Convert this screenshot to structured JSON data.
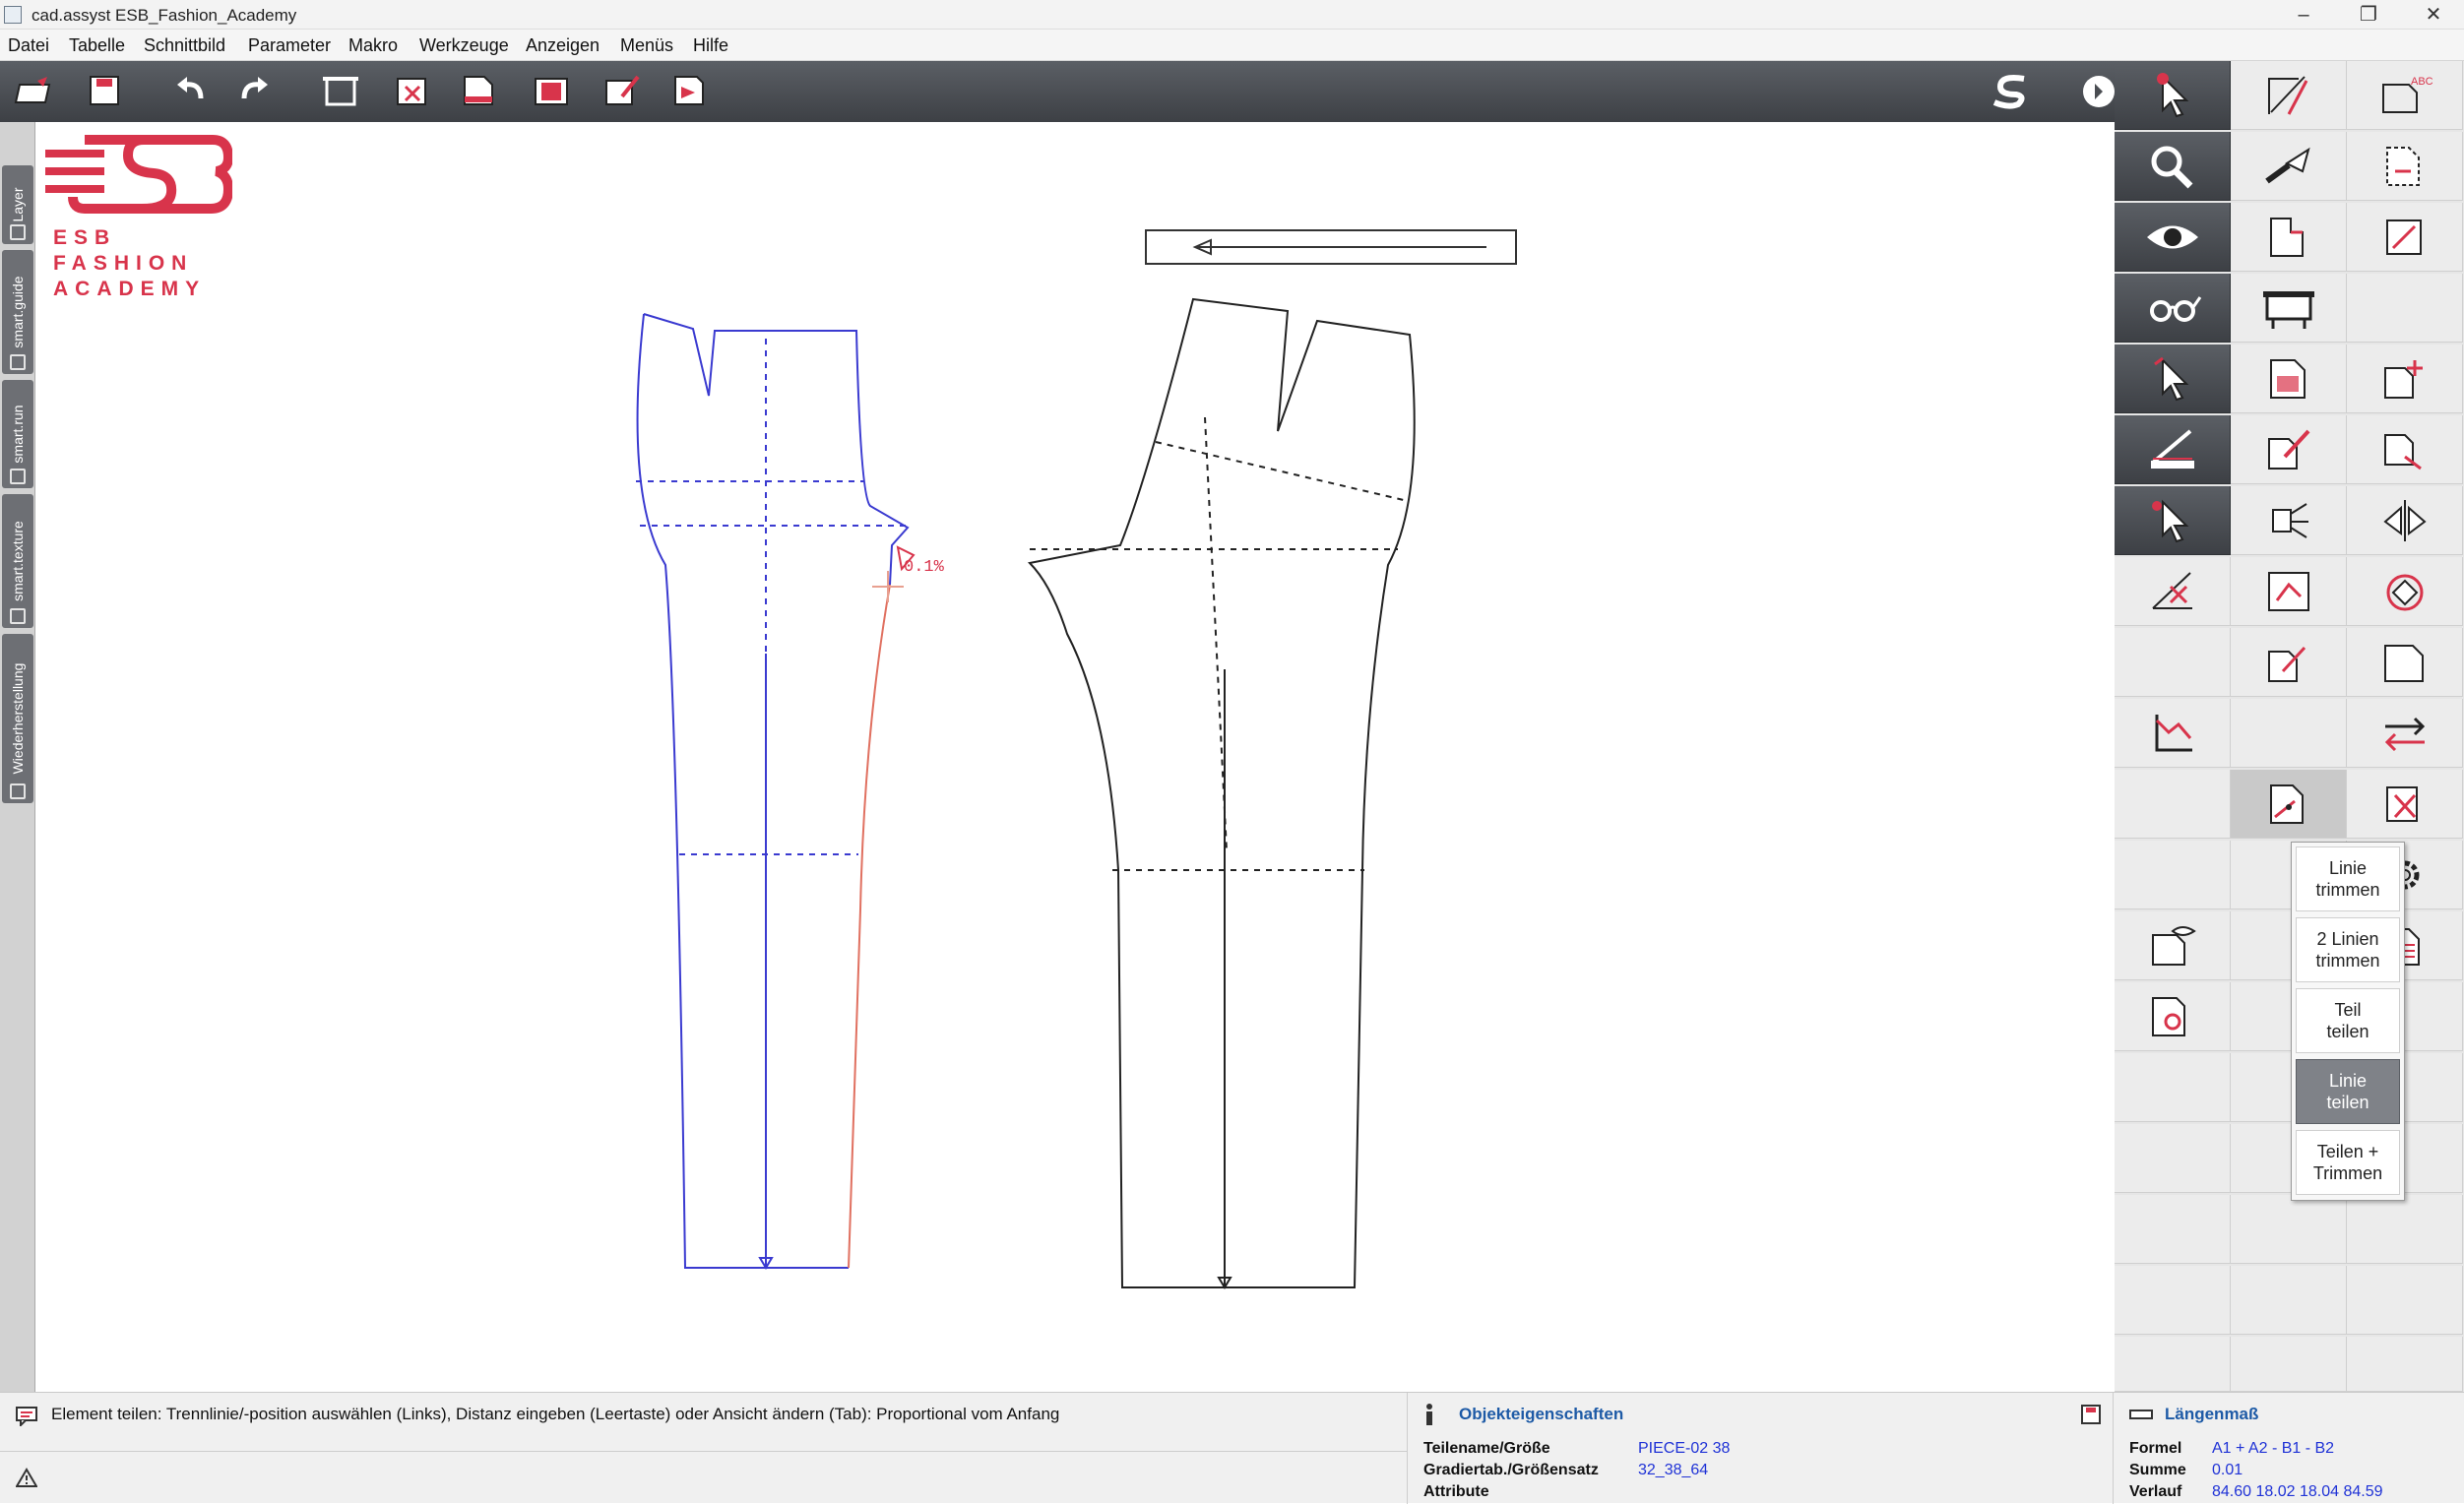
{
  "window": {
    "title": "cad.assyst  ESB_Fashion_Academy"
  },
  "menu": [
    "Datei",
    "Tabelle",
    "Schnittbild",
    "Parameter",
    "Makro",
    "Werkzeuge",
    "Anzeigen",
    "Menüs",
    "Hilfe"
  ],
  "left_tabs": [
    "Layer",
    "smart.guide",
    "smart.run",
    "smart.texture",
    "Wiederherstellung"
  ],
  "logo": {
    "line1": "ESB",
    "line2": "FASHION",
    "line3": "ACADEMY",
    "color": "#d8344b"
  },
  "canvas": {
    "measure_label": "0.1%"
  },
  "popup": {
    "items": [
      "Linie\ntrimmen",
      "2 Linien\ntrimmen",
      "Teil\nteilen",
      "Linie\nteilen",
      "Teilen +\nTrimmen"
    ],
    "selected_index": 3
  },
  "status": {
    "message": "Element teilen: Trennlinie/-position auswählen (Links), Distanz eingeben (Leertaste) oder Ansicht ändern (Tab): Proportional vom Anfang",
    "warning_icon": "warning-icon"
  },
  "object_properties": {
    "title": "Objekteigenschaften",
    "rows": [
      {
        "label": "Teilename/Größe",
        "value": "PIECE-02 38"
      },
      {
        "label": "Gradiertab./Größensatz",
        "value": "32_38_64"
      },
      {
        "label": "Attribute",
        "value": ""
      }
    ]
  },
  "length_measure": {
    "title": "Längenmaß",
    "rows": [
      {
        "label": "Formel",
        "value": "A1 + A2 - B1 - B2"
      },
      {
        "label": "Summe",
        "value": "0.01"
      },
      {
        "label": "Verlauf",
        "value": "84.60 18.02 18.04 84.59"
      }
    ]
  },
  "colors": {
    "accent": "#d8344b",
    "piece_blue": "#3a3ad0",
    "piece_red": "#e07060",
    "toolbar": "#4a4d52"
  }
}
